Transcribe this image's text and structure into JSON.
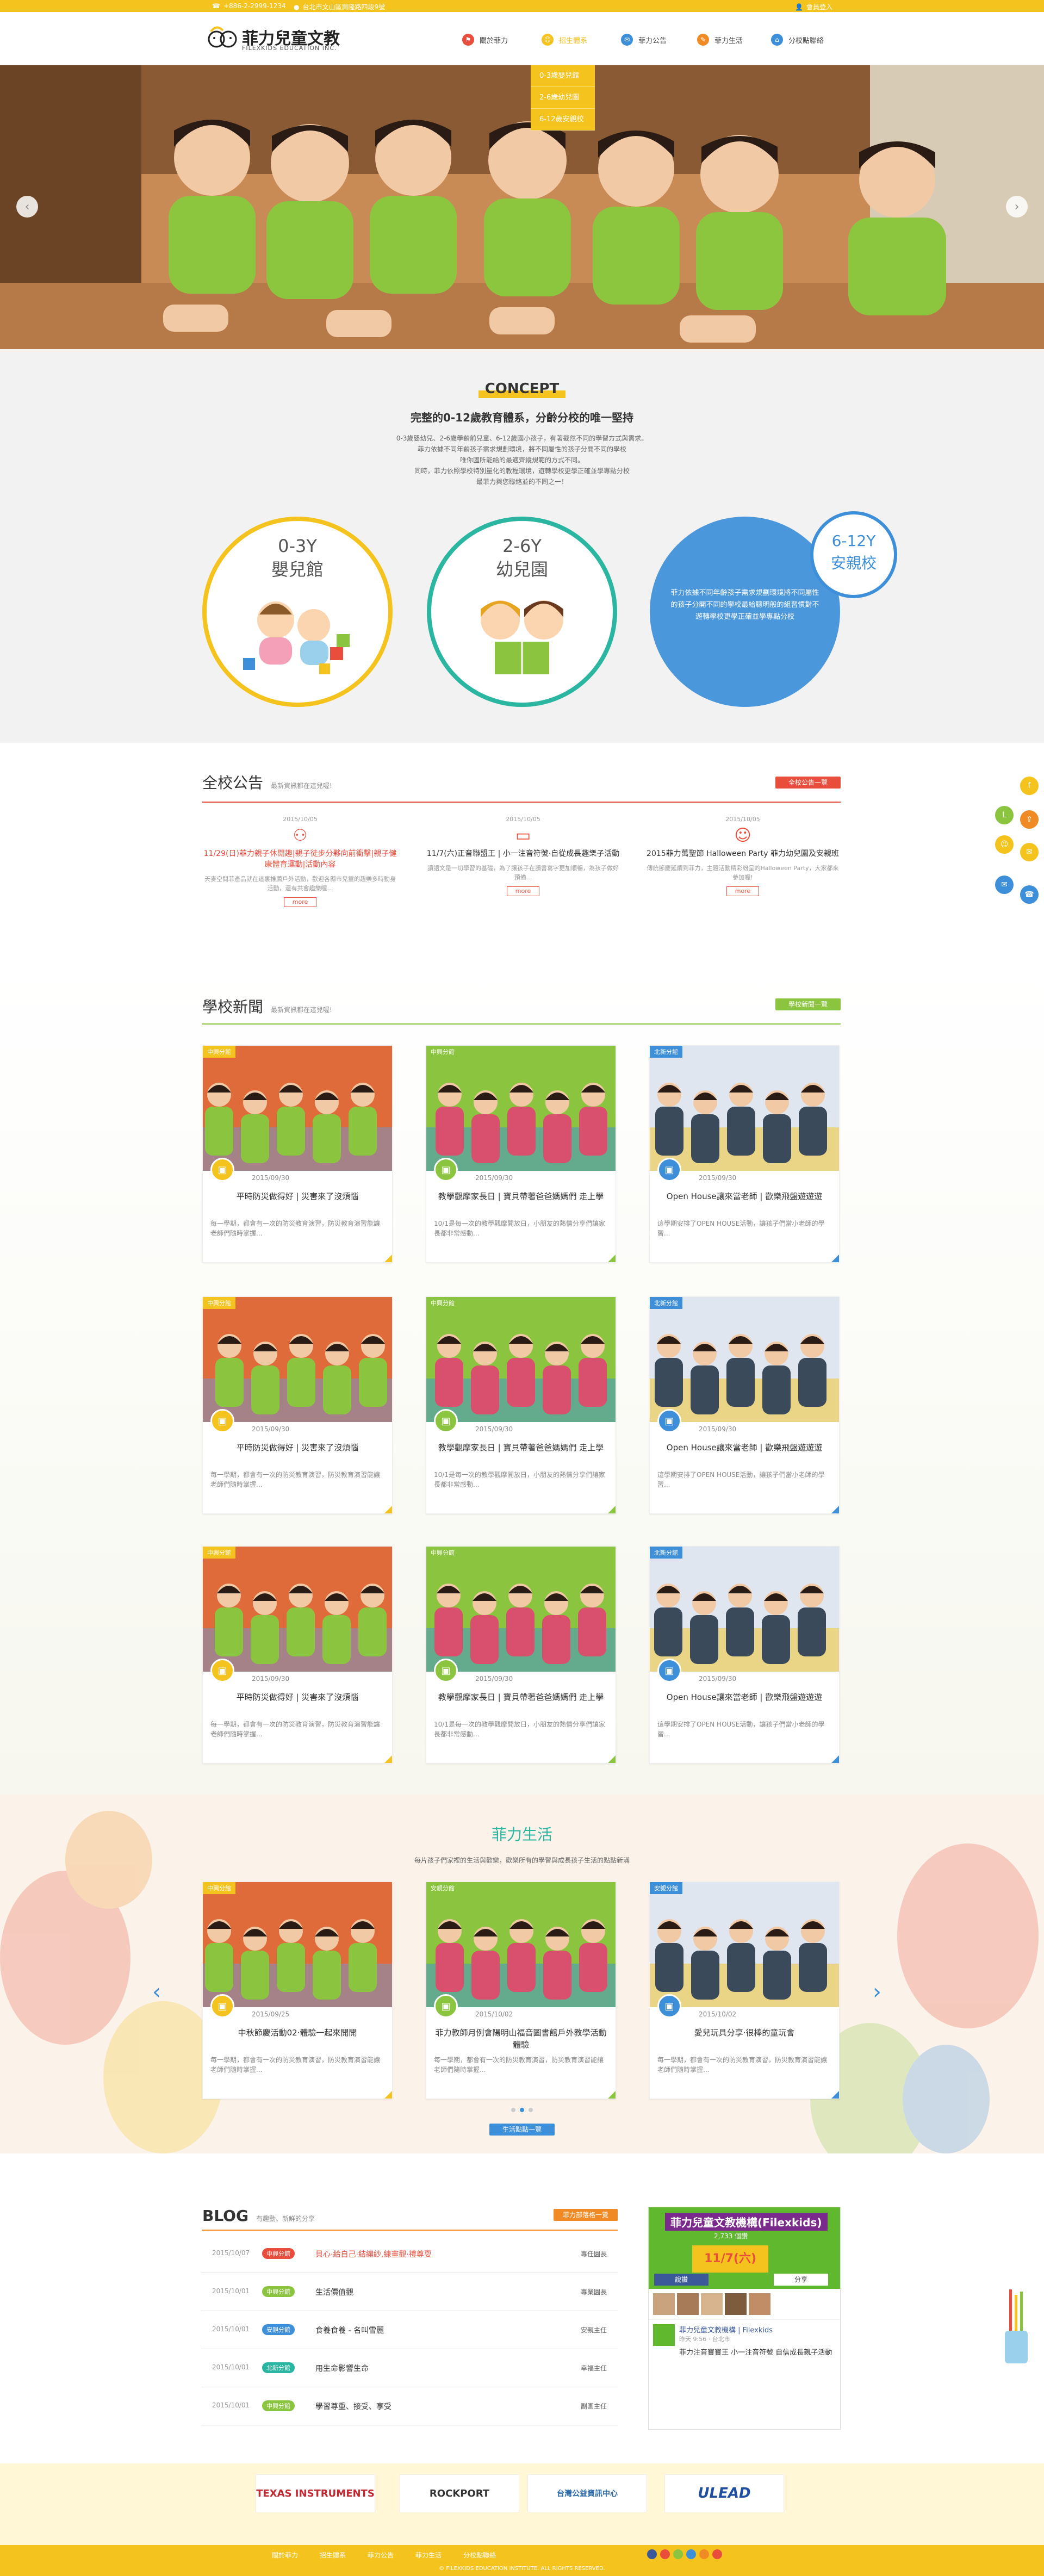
{
  "topbar": {
    "phone": "+886-2-2999-1234",
    "address": "台北市文山區興隆路四段9號",
    "member": "會員登入"
  },
  "brand": {
    "name": "菲力兒童文教",
    "sub": "FILEXKIDS EDUCATION INC."
  },
  "nav": [
    {
      "label": "關於菲力",
      "icon": "flag-icon",
      "color": "#e94e3c"
    },
    {
      "label": "招生體系",
      "icon": "children-icon",
      "color": "#f5c31d"
    },
    {
      "label": "菲力公告",
      "icon": "megaphone-icon",
      "color": "#3d8fd9"
    },
    {
      "label": "菲力生活",
      "icon": "chat-icon",
      "color": "#f08a24"
    },
    {
      "label": "分校點聯絡",
      "icon": "location-icon",
      "color": "#3d8fd9"
    }
  ],
  "dropdown": [
    "0-3歲嬰兒館",
    "2-6歲幼兒園",
    "6-12歲安親校"
  ],
  "concept": {
    "title": "CONCEPT",
    "heading": "完整的0-12歲教育體系，分齡分校的唯一堅持",
    "lines": [
      "0-3歲嬰幼兒、2-6歲學齡前兒童、6-12歲國小孩子，有著截然不同的學習方式與需求。",
      "菲力依據不同年齡孩子需求規劃環境，將不同屬性的孩子分開不同的學校",
      "唯你國所能給的最適齊縱規範的方式不同。",
      "同時，菲力依照學校特別量化的教程環境，遊轉學校更學正確並學專點分校",
      "最菲力與您聯絡並的不同之一！"
    ],
    "circles": [
      {
        "age": "0-3Y",
        "name": "嬰兒館"
      },
      {
        "age": "2-6Y",
        "name": "幼兒園"
      },
      {
        "age": "6-12Y",
        "name": "安親校",
        "desc": "菲力依據不同年齡孩子需求規劃環境將不同屬性的孩子分開不同的學校最給聰明般的組習慣對不遊轉學校更學正確並學專點分校"
      }
    ]
  },
  "notice": {
    "title": "全校公告",
    "sub": "最新資訊都在這兒喔!",
    "more": "全校公告一覽",
    "items": [
      {
        "date": "2015/10/05",
        "title": "11/29(日)菲力親子休閒趣|親子徒步分夥向前衝擊|親子健康體育運動|活動內容",
        "desc": "天麥空間菲產品就在這裏推薦戶外活動，歡迎各縣市兒童的趣樂多時動身活動，還有共會趣樂喔…",
        "color": "#e94e3c"
      },
      {
        "date": "2015/10/05",
        "title": "11/7(六)正音聯盟王 | 小一注音符號·自從成長趣樂子活動",
        "desc": "讀語文是一切學習的基礎，為了讓孩子在讀書寫字更加順暢，為孩子做好預備...",
        "color": "#333"
      },
      {
        "date": "2015/10/05",
        "title": "2015菲力萬聖節 Halloween Party 菲力幼兒園及安親班",
        "desc": "傳統節慶延續到菲力，主題活動精彩紛呈的Halloween Party，大家都來參加喔!",
        "color": "#333"
      }
    ],
    "more_label": "more"
  },
  "news": {
    "title": "學校新聞",
    "sub": "最新資訊都在這兒喔!",
    "more": "學校新聞一覽",
    "items": [
      {
        "tag": "中興分館",
        "date": "2015/09/30",
        "title": "平時防災做得好 | 災害來了沒煩惱",
        "desc": "每一學期，都會有一次的防災教育演習，防災教育演習能讓老師們隨時掌握..."
      },
      {
        "tag": "中興分館",
        "date": "2015/09/30",
        "title": "教學觀摩家長日 | 寶貝帶著爸爸媽媽們 走上學",
        "desc": "10/1是每一次的教學觀摩開放日，小朋友的熱情分享們讓家長都非常感動..."
      },
      {
        "tag": "北新分館",
        "date": "2015/09/30",
        "title": "Open House讓來當老師 | 歡樂飛盤遊遊遊",
        "desc": "這學期安排了OPEN HOUSE活動，讓孩子們當小老師的學習..."
      },
      {
        "tag": "中興分館",
        "date": "2015/09/30",
        "title": "平時防災做得好 | 災害來了沒煩惱",
        "desc": "每一學期，都會有一次的防災教育演習，防災教育演習能讓老師們隨時掌握..."
      },
      {
        "tag": "中興分館",
        "date": "2015/09/30",
        "title": "教學觀摩家長日 | 寶貝帶著爸爸媽媽們 走上學",
        "desc": "10/1是每一次的教學觀摩開放日，小朋友的熱情分享們讓家長都非常感動..."
      },
      {
        "tag": "北新分館",
        "date": "2015/09/30",
        "title": "Open House讓來當老師 | 歡樂飛盤遊遊遊",
        "desc": "這學期安排了OPEN HOUSE活動，讓孩子們當小老師的學習..."
      },
      {
        "tag": "中興分館",
        "date": "2015/09/30",
        "title": "平時防災做得好 | 災害來了沒煩惱",
        "desc": "每一學期，都會有一次的防災教育演習，防災教育演習能讓老師們隨時掌握..."
      },
      {
        "tag": "中興分館",
        "date": "2015/09/30",
        "title": "教學觀摩家長日 | 寶貝帶著爸爸媽媽們 走上學",
        "desc": "10/1是每一次的教學觀摩開放日，小朋友的熱情分享們讓家長都非常感動..."
      },
      {
        "tag": "北新分館",
        "date": "2015/09/30",
        "title": "Open House讓來當老師 | 歡樂飛盤遊遊遊",
        "desc": "這學期安排了OPEN HOUSE活動，讓孩子們當小老師的學習..."
      }
    ]
  },
  "life": {
    "title": "菲力生活",
    "sub": "每片孩子們家裡的生活與歡樂，歡樂所有的學習與成長孩子生活的點點新滿",
    "more": "生活點點一覽",
    "items": [
      {
        "tag": "中興分館",
        "date": "2015/09/25",
        "title": "中秋節慶活動02·體驗一起來開開",
        "desc": "每一學期，都會有一次的防災教育演習，防災教育演習能讓老師們隨時掌握..."
      },
      {
        "tag": "安親分館",
        "date": "2015/10/02",
        "title": "菲力教師月例會陽明山福音圖書館戶外教學活動體驗",
        "desc": "每一學期，都會有一次的防災教育演習，防災教育演習能讓老師們隨時掌握..."
      },
      {
        "tag": "安親分館",
        "date": "2015/10/02",
        "title": "愛兒玩具分享·很棒的童玩會",
        "desc": "每一學期，都會有一次的防災教育演習，防災教育演習能讓老師們隨時掌握..."
      }
    ]
  },
  "blog": {
    "title": "BLOG",
    "sub": "有趣動、新鮮的分享",
    "more": "菲力部落格一覽",
    "rows": [
      {
        "date": "2015/10/07",
        "tag": "中興分館",
        "title": "貝心·給自己·結繃紗,練晝觀·禮尊耍",
        "author": "專任園長",
        "tagcolor": "#e94e3c",
        "titlecolor": "#e94e3c"
      },
      {
        "date": "2015/10/01",
        "tag": "中興分館",
        "title": "生活價值觀",
        "author": "專業園長",
        "tagcolor": "#8bc53f",
        "titlecolor": "#333"
      },
      {
        "date": "2015/10/01",
        "tag": "安親分館",
        "title": "食養食養 - 名叫雪麗",
        "author": "安親主任",
        "tagcolor": "#3d8fd9",
        "titlecolor": "#333"
      },
      {
        "date": "2015/10/01",
        "tag": "北新分館",
        "title": "用生命影響生命",
        "author": "幸福主任",
        "tagcolor": "#2ab6a1",
        "titlecolor": "#333"
      },
      {
        "date": "2015/10/01",
        "tag": "中興分館",
        "title": "學習尊重、接受、享受",
        "author": "副園主任",
        "tagcolor": "#8bc53f",
        "titlecolor": "#333"
      }
    ],
    "fb": {
      "page": "菲力兒童文教機構(Filexkids)",
      "likes": "2,733 個讚",
      "like_btn": "說讚",
      "share_btn": "分享",
      "post_name": "菲力兒童文教機構 | Filexkids",
      "post_time": "昨天 9:56 · 台北市",
      "post_text": "菲力注音寶寶王 小一注音符號 自信成長親子活動",
      "banner": "11/7(六)"
    }
  },
  "partners": [
    "TEXAS INSTRUMENTS",
    "ROCKPORT",
    "台灣公益資訊中心",
    "ULEAD"
  ],
  "footer": {
    "links": [
      "關於菲力",
      "招生體系",
      "菲力公告",
      "菲力生活",
      "分校點聯絡"
    ],
    "copyright": "© FILEXKIDS EDUCATION INSTITUTE. ALL RIGHTS RESERVED."
  },
  "colors": {
    "yellow": "#f5c31d",
    "green": "#8bc53f",
    "red": "#e94e3c",
    "blue": "#3d8fd9",
    "teal": "#2ab6a1"
  }
}
